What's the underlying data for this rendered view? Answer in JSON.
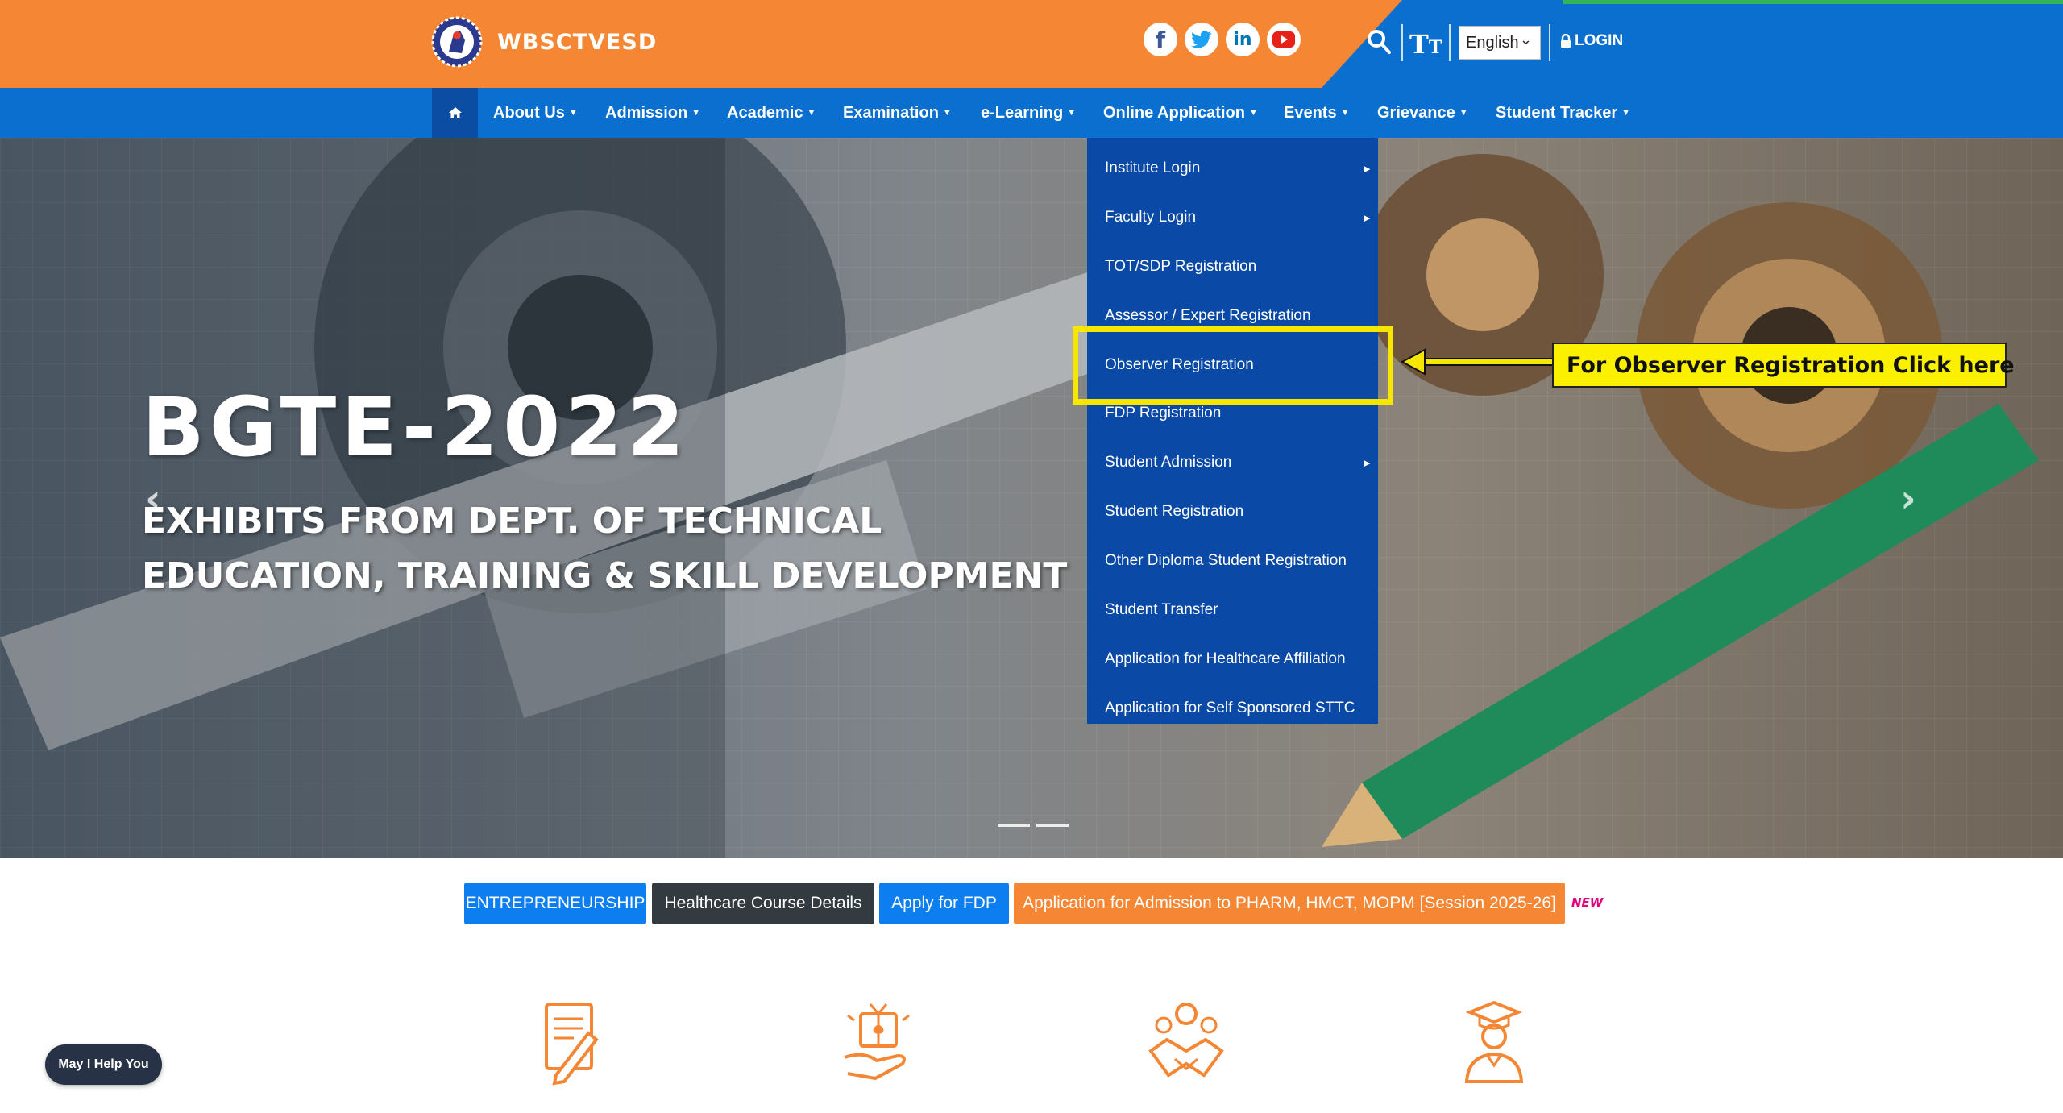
{
  "header": {
    "site_name": "WBSCTVESD",
    "social": [
      "facebook-icon",
      "twitter-icon",
      "linkedin-icon",
      "youtube-icon"
    ],
    "text_size_big": "T",
    "text_size_small": "T",
    "language": "English",
    "login_label": "LOGIN",
    "colors": {
      "orange": "#f58634",
      "blue": "#0b6fd0",
      "dark_blue": "#0a4aa6"
    }
  },
  "nav": {
    "items": [
      {
        "label": "About Us"
      },
      {
        "label": "Admission"
      },
      {
        "label": "Academic"
      },
      {
        "label": "Examination"
      },
      {
        "label": "e-Learning"
      },
      {
        "label": "Online Application"
      },
      {
        "label": "Events"
      },
      {
        "label": "Grievance"
      },
      {
        "label": "Student Tracker"
      }
    ]
  },
  "dropdown": {
    "items": [
      {
        "label": "Institute Login",
        "submenu": true
      },
      {
        "label": "Faculty Login",
        "submenu": true
      },
      {
        "label": "TOT/SDP Registration",
        "submenu": false
      },
      {
        "label": "Assessor / Expert Registration",
        "submenu": false
      },
      {
        "label": "Observer Registration",
        "submenu": false,
        "active": true
      },
      {
        "label": "FDP Registration",
        "submenu": false
      },
      {
        "label": "Student Admission",
        "submenu": true
      },
      {
        "label": "Student Registration",
        "submenu": false
      },
      {
        "label": "Other Diploma Student Registration",
        "submenu": false
      },
      {
        "label": "Student Transfer",
        "submenu": false
      },
      {
        "label": "Application for Healthcare Affiliation",
        "submenu": false
      },
      {
        "label": "Application for Self Sponsored STTC",
        "submenu": false
      }
    ]
  },
  "annotation": {
    "callout": "For Observer Registration Click here"
  },
  "hero": {
    "title": "BGTE-2022",
    "subtitle_line1": "EXHIBITS FROM DEPT. OF TECHNICAL",
    "subtitle_line2": "EDUCATION, TRAINING & SKILL DEVELOPMENT",
    "prev": "‹",
    "next": "›"
  },
  "quick_links": {
    "entrepreneurship": "ENTREPRENEURSHIP",
    "healthcare": "Healthcare Course Details",
    "fdp": "Apply for FDP",
    "admission": "Application for Admission to PHARM, HMCT, MOPM [Session 2025-26]",
    "new_badge": "NEW"
  },
  "features": [
    "document-pen-icon",
    "gift-hand-icon",
    "handshake-people-icon",
    "graduate-icon"
  ],
  "chat": {
    "label": "May I Help You"
  }
}
